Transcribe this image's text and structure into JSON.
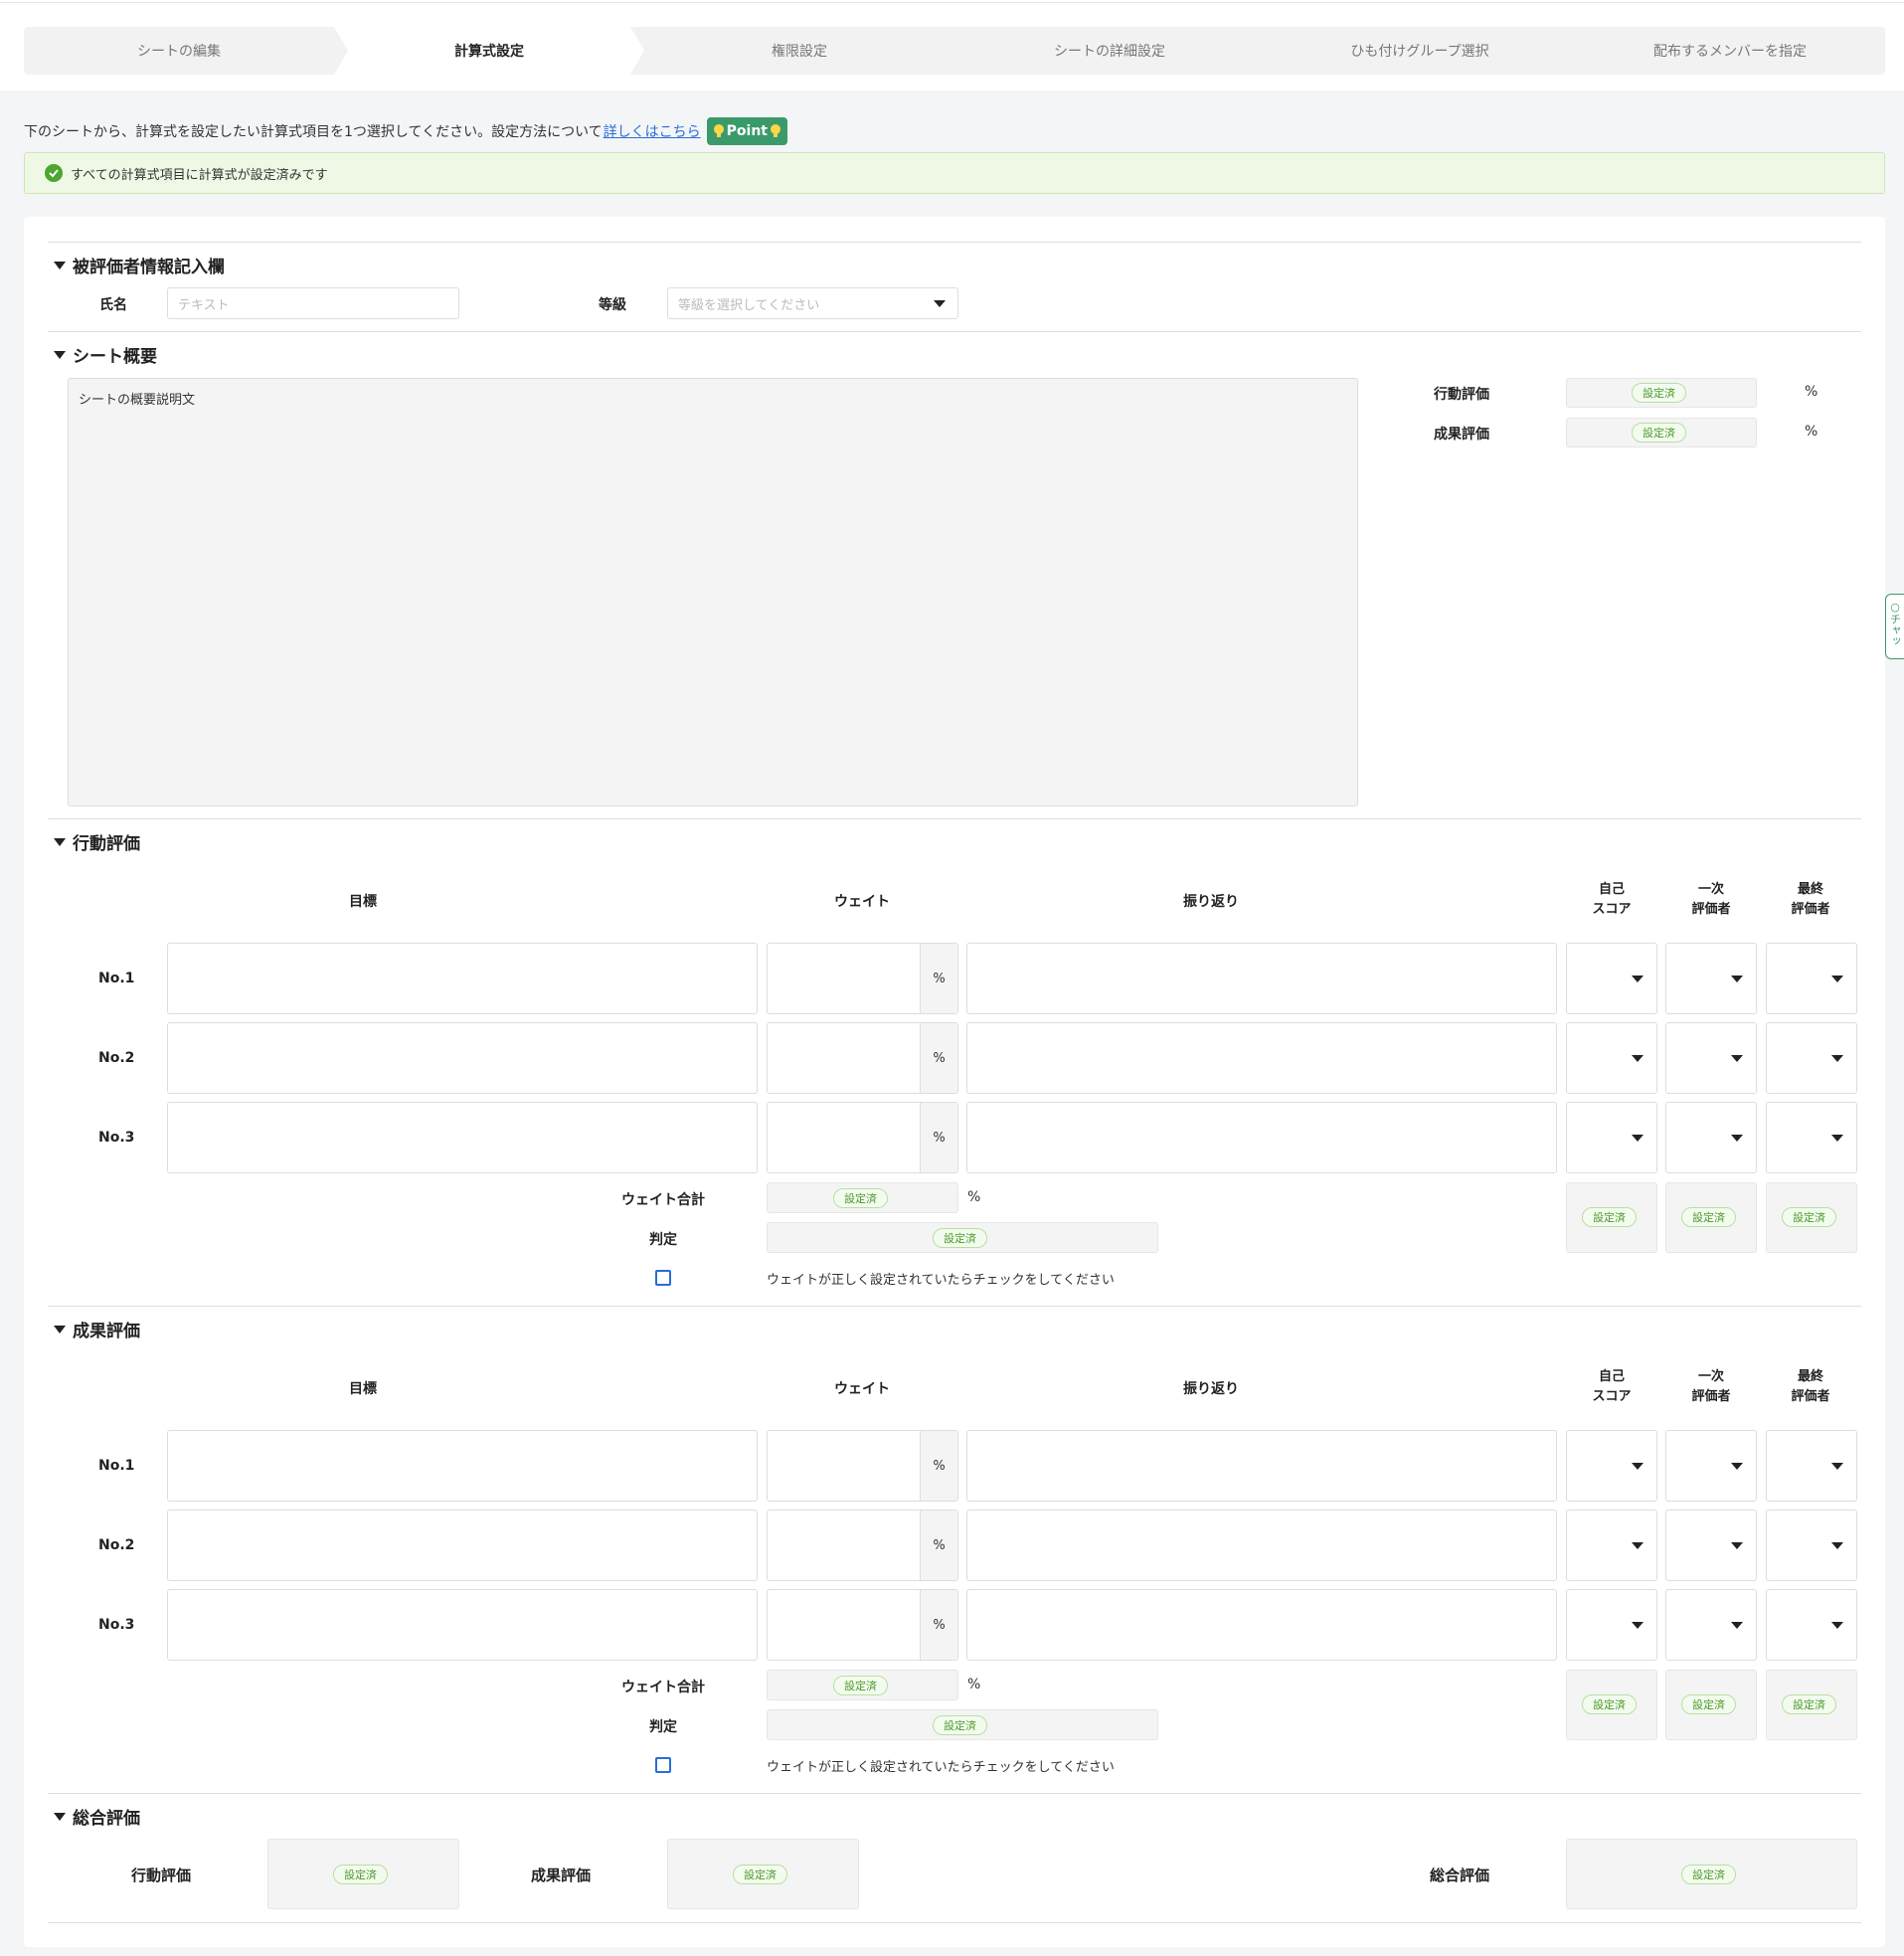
{
  "steps": [
    {
      "label": "シートの編集"
    },
    {
      "label": "計算式設定"
    },
    {
      "label": "権限設定"
    },
    {
      "label": "シートの詳細設定"
    },
    {
      "label": "ひも付けグループ選択"
    },
    {
      "label": "配布するメンバーを指定"
    }
  ],
  "instruction": {
    "text": "下のシートから、計算式を設定したい計算式項目を1つ選択してください。設定方法について",
    "link": "詳しくはこちら",
    "point": "Point"
  },
  "success": "すべての計算式項目に計算式が設定済みです",
  "chat": "チャッ",
  "set_label": "設定済",
  "pct": "%",
  "evaluee": {
    "title": "被評価者情報記入欄",
    "name_label": "氏名",
    "name_placeholder": "テキスト",
    "grade_label": "等級",
    "grade_placeholder": "等級を選択してください"
  },
  "overview": {
    "title": "シート概要",
    "desc": "シートの概要説明文",
    "behavior_label": "行動評価",
    "result_label": "成果評価"
  },
  "cols": {
    "goal": "目標",
    "weight": "ウェイト",
    "reflect": "振り返り",
    "self": "自己\nスコア",
    "first": "一次\n評価者",
    "final": "最終\n評価者"
  },
  "sections": [
    {
      "title": "行動評価",
      "rows": [
        "No.1",
        "No.2",
        "No.3"
      ],
      "weight_total": "ウェイト合計",
      "judge": "判定",
      "check_note": "ウェイトが正しく設定されていたらチェックをしてください"
    },
    {
      "title": "成果評価",
      "rows": [
        "No.1",
        "No.2",
        "No.3"
      ],
      "weight_total": "ウェイト合計",
      "judge": "判定",
      "check_note": "ウェイトが正しく設定されていたらチェックをしてください"
    }
  ],
  "total": {
    "title": "総合評価",
    "behavior": "行動評価",
    "result": "成果評価",
    "overall": "総合評価"
  }
}
